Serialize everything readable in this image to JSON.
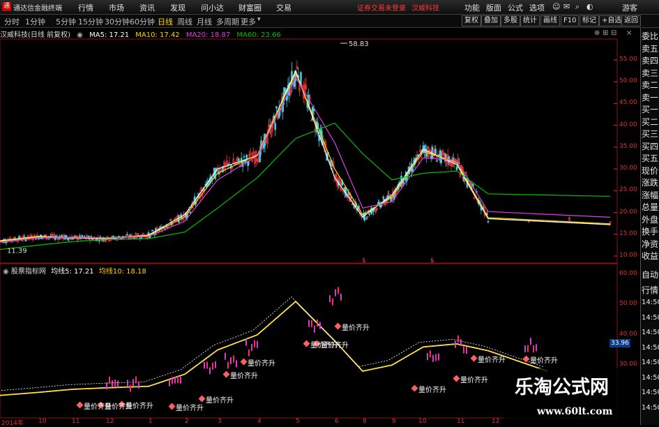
{
  "titlebar": {
    "app_name": "通达信金融终端",
    "menu": [
      "行情",
      "市场",
      "资讯",
      "发现",
      "问小达",
      "财富圈",
      "交易"
    ],
    "warning": "证券交易未登录",
    "stock_name": "汉威科技",
    "right_menu": [
      "功能",
      "版面",
      "公式",
      "选项"
    ],
    "guest": "游客",
    "window_buttons": [
      "–",
      "□",
      "×"
    ]
  },
  "periodbar": {
    "tabs": [
      "分时",
      "1分钟",
      "5分钟",
      "15分钟",
      "30分钟",
      "60分钟",
      "日线",
      "周线",
      "月线",
      "多周期",
      "更多"
    ],
    "active": "日线",
    "right_buttons": [
      "复权",
      "叠加",
      "多股",
      "统计",
      "画线",
      "F10",
      "标记",
      "+自选",
      "返回"
    ]
  },
  "main_info": {
    "title": "汉威科技(日线 前复权)",
    "ma5": "MA5: 17.21",
    "ma10": "MA10: 17.42",
    "ma20": "MA20: 18.87",
    "ma60": "MA60: 23.66",
    "ma5_color": "#ffffff",
    "ma10_color": "#ffd400",
    "ma20_color": "#e040e0",
    "ma60_color": "#00c000",
    "peak_label": "58.83",
    "low_label": "11.39"
  },
  "main_yaxis": [
    "55.00",
    "50.00",
    "45.00",
    "40.00",
    "35.00",
    "30.00",
    "25.00",
    "20.00",
    "15.00",
    "10.00"
  ],
  "sub_info": {
    "title": "股票指标网",
    "line5": "均线5: 17.21",
    "line10": "均线10: 18.18"
  },
  "sub_yaxis": [
    "60.00",
    "50.00",
    "40.00",
    "30.00"
  ],
  "sub_box_value": "33.96",
  "signal_label": "量价齐升",
  "xaxis": [
    "2014年",
    "10",
    "11",
    "12",
    "1",
    "2",
    "3",
    "4",
    "5",
    "6",
    "8",
    "9",
    "10",
    "11",
    "12"
  ],
  "right_panel": [
    "委比",
    "卖五",
    "卖四",
    "卖三",
    "卖二",
    "卖一",
    "买一",
    "买二",
    "买三",
    "买四",
    "买五",
    "现价",
    "涨跌",
    "涨幅",
    "总量",
    "外盘",
    "换手",
    "净资",
    "收益",
    "",
    "自动",
    "行情",
    "14:50",
    "14:50",
    "14:50",
    "14:50",
    "14:50",
    "14:50",
    "14:50",
    "14:50"
  ],
  "watermark": {
    "cn": "乐淘公式网",
    "url": "www.60lt.com"
  },
  "chart_data": {
    "type": "line",
    "title": "汉威科技(日线 前复权)",
    "x": [
      "2014-10",
      "2014-11",
      "2014-12",
      "2015-01",
      "2015-02",
      "2015-03",
      "2015-04",
      "2015-05",
      "2015-06",
      "2015-07",
      "2015-08",
      "2015-09",
      "2015-10",
      "2015-11",
      "2015-12"
    ],
    "series": [
      {
        "name": "MA5",
        "values": [
          13.5,
          14.5,
          14.2,
          14.0,
          14.8,
          19.5,
          30.0,
          33.0,
          52.5,
          28.0,
          19.0,
          24.0,
          34.5,
          31.0,
          17.2
        ]
      },
      {
        "name": "MA10",
        "values": [
          13.4,
          14.4,
          14.2,
          14.1,
          14.7,
          19.0,
          29.0,
          33.2,
          52.0,
          30.0,
          19.5,
          23.5,
          34.0,
          31.5,
          17.4
        ]
      },
      {
        "name": "MA20",
        "values": [
          13.2,
          14.2,
          14.3,
          14.2,
          14.5,
          18.0,
          27.5,
          33.0,
          51.0,
          36.0,
          21.0,
          22.5,
          32.5,
          32.0,
          18.9
        ]
      },
      {
        "name": "MA60",
        "values": [
          11.5,
          12.5,
          13.3,
          13.8,
          14.0,
          15.5,
          21.0,
          28.0,
          37.0,
          40.5,
          33.5,
          27.5,
          29.0,
          29.5,
          23.7
        ]
      }
    ],
    "ylim": [
      10,
      58.83
    ],
    "annotations": [
      "58.83",
      "11.39"
    ]
  }
}
